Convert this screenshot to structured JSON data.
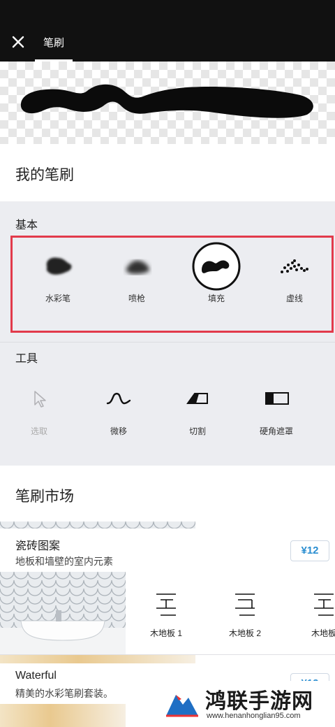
{
  "header": {
    "tab_label": "笔刷"
  },
  "my_brushes": {
    "title": "我的笔刷"
  },
  "basic": {
    "label": "基本",
    "items": [
      {
        "label": "水彩笔",
        "icon": "watercolor-blob-icon"
      },
      {
        "label": "喷枪",
        "icon": "airbrush-icon"
      },
      {
        "label": "填充",
        "icon": "fill-brush-icon"
      },
      {
        "label": "虚线",
        "icon": "dotted-line-icon"
      }
    ]
  },
  "tools": {
    "label": "工具",
    "items": [
      {
        "label": "选取",
        "icon": "cursor-arrow-icon",
        "disabled": true
      },
      {
        "label": "微移",
        "icon": "wave-icon"
      },
      {
        "label": "切割",
        "icon": "cut-icon"
      },
      {
        "label": "硬角遮罩",
        "icon": "hard-mask-icon"
      }
    ]
  },
  "market": {
    "title": "笔刷市场",
    "packs": [
      {
        "title": "瓷砖图案",
        "subtitle": "地板和墙壁的室内元素",
        "price": "¥12",
        "brushes": [
          {
            "label": "木地板 1"
          },
          {
            "label": "木地板 2"
          },
          {
            "label": "木地板"
          }
        ]
      },
      {
        "title": "Waterful",
        "subtitle": "精美的水彩笔刷套装。",
        "price": "¥12"
      }
    ]
  },
  "watermark": {
    "title": "鸿联手游网",
    "url": "www.henanhonglian95.com"
  },
  "colors": {
    "highlight": "#e23a4b",
    "price": "#2a8ed1",
    "topbar": "#111111"
  }
}
